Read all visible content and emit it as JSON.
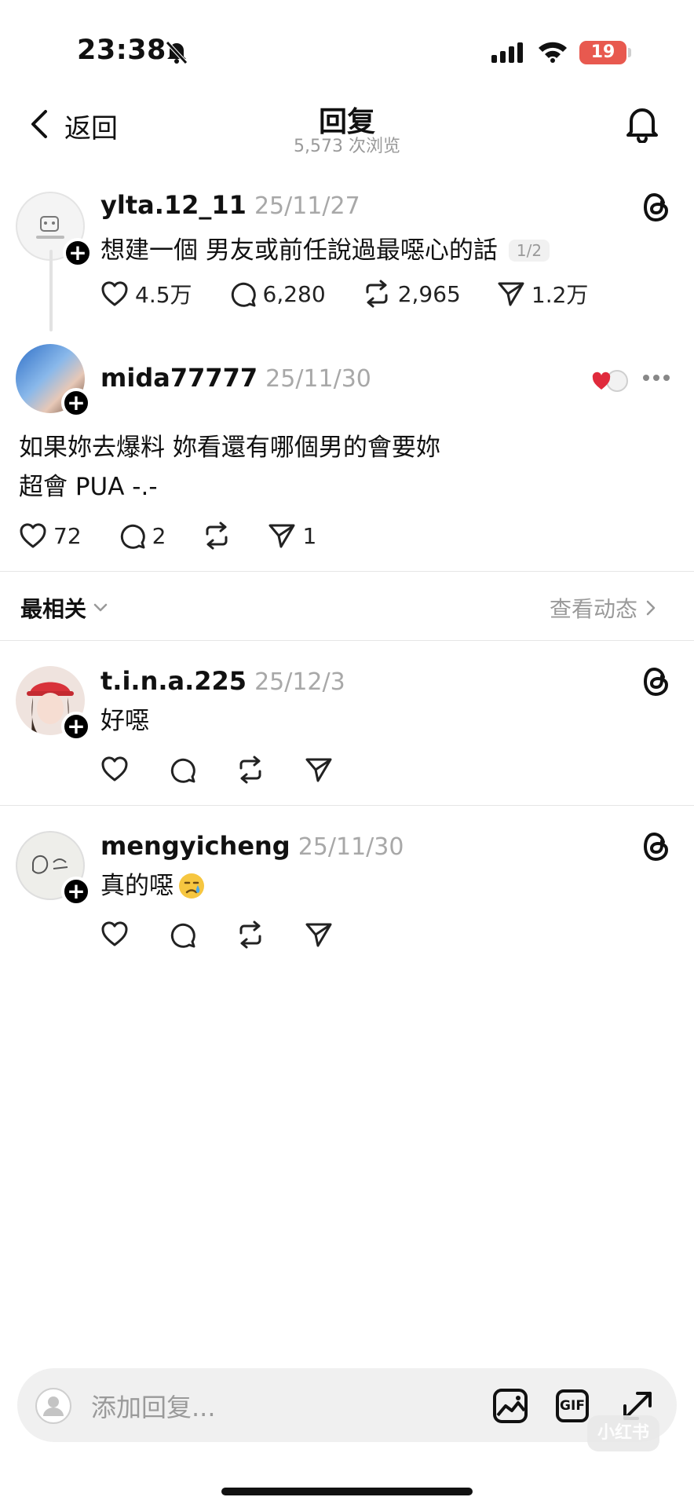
{
  "status_bar": {
    "time": "23:38",
    "battery": "19"
  },
  "header": {
    "back_label": "返回",
    "title": "回复",
    "view_count": "5,573 次浏览"
  },
  "original_post": {
    "username": "ylta.12_11",
    "date": "25/11/27",
    "text": "想建一個 男友或前任說過最噁心的話",
    "page_badge": "1/2",
    "likes": "4.5万",
    "comments": "6,280",
    "reposts": "2,965",
    "shares": "1.2万"
  },
  "focused_reply": {
    "username": "mida77777",
    "date": "25/11/30",
    "text_line1": "如果妳去爆料 妳看還有哪個男的會要妳",
    "text_line2": "超會 PUA -.-",
    "likes": "72",
    "comments": "2",
    "shares": "1"
  },
  "sort_bar": {
    "sort_label": "最相关",
    "activity_link": "查看动态"
  },
  "replies": [
    {
      "username": "t.i.n.a.225",
      "date": "25/12/3",
      "text": "好噁"
    },
    {
      "username": "mengyicheng",
      "date": "25/11/30",
      "text": "真的噁"
    }
  ],
  "reply_bar": {
    "placeholder": "添加回复...",
    "gif_label": "GIF"
  },
  "watermark": "小红书",
  "colors": {
    "battery": "#e8594f",
    "like_heart": "#e02a3c",
    "muted_text": "#9a9a9a"
  },
  "icons": [
    "bell-off-icon",
    "signal-icon",
    "wifi-icon",
    "chevron-left-icon",
    "bell-icon",
    "threads-icon",
    "heart-icon",
    "comment-icon",
    "repost-icon",
    "share-icon",
    "more-icon",
    "image-icon",
    "gif-icon",
    "expand-icon"
  ]
}
